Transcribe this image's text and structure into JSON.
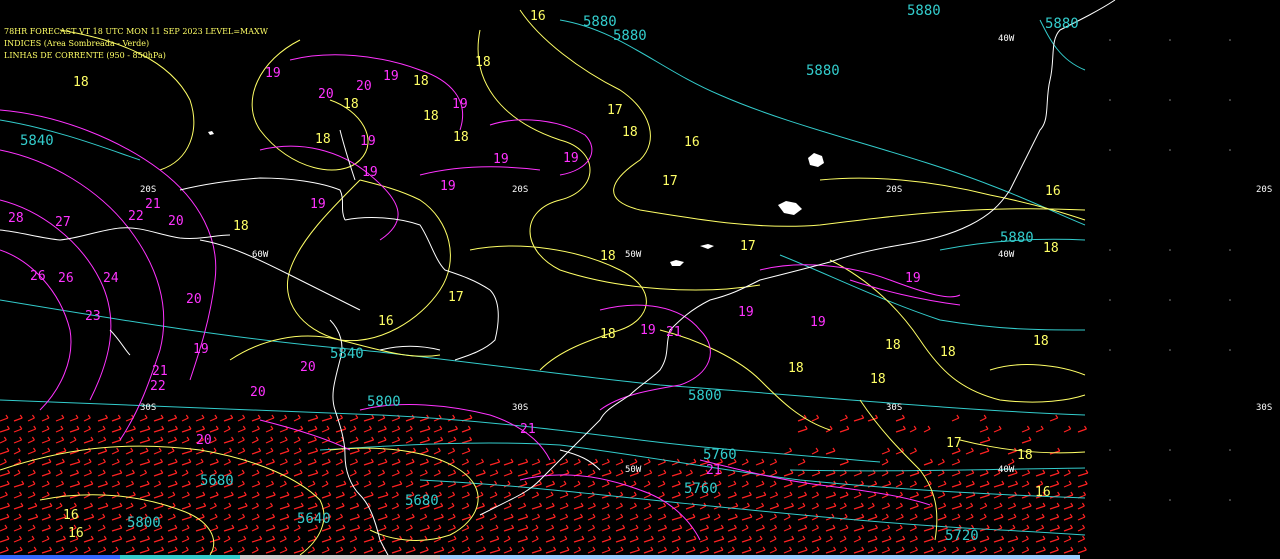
{
  "header": {
    "line1": "78HR FORECAST   VT 18 UTC MON 11 SEP 2023   LEVEL=MAXW",
    "line2": "INDICES (Area Sombreada - Verde)",
    "line3": "LINHAS DE CORRENTE (950 - 850hPa)"
  },
  "colors": {
    "background": "#000000",
    "coast": "#ffffff",
    "height_contours": "#33cccc",
    "yellow_contours": "#ffff66",
    "magenta_contours": "#ff33ff",
    "wind_barbs": "#ff2222",
    "grid_labels": "#ffffff"
  },
  "grid_labels": {
    "lat_20s": "20S",
    "lat_30s": "30S",
    "lon_60w": "60W",
    "lon_50w": "50W",
    "lon_40w": "40W"
  },
  "height_values": [
    "5880",
    "5880",
    "5880",
    "5880",
    "5880",
    "5880",
    "5840",
    "5840",
    "5800",
    "5800",
    "5760",
    "5760",
    "5720",
    "5680",
    "5640",
    "5800",
    "5680"
  ],
  "yellow_values": [
    "16",
    "18",
    "18",
    "18",
    "18",
    "18",
    "18",
    "18",
    "18",
    "17",
    "17",
    "17",
    "16",
    "16",
    "18",
    "18",
    "18",
    "18",
    "18",
    "18",
    "17",
    "18",
    "16",
    "18",
    "18",
    "16",
    "18",
    "16",
    "17",
    "16"
  ],
  "magenta_values": [
    "19",
    "19",
    "20",
    "20",
    "19",
    "19",
    "19",
    "19",
    "19",
    "19",
    "19",
    "21",
    "22",
    "27",
    "28",
    "24",
    "26",
    "23",
    "20",
    "19",
    "20",
    "21",
    "22",
    "20",
    "20",
    "19",
    "19",
    "19",
    "19",
    "21",
    "20",
    "21",
    "21",
    "26"
  ]
}
